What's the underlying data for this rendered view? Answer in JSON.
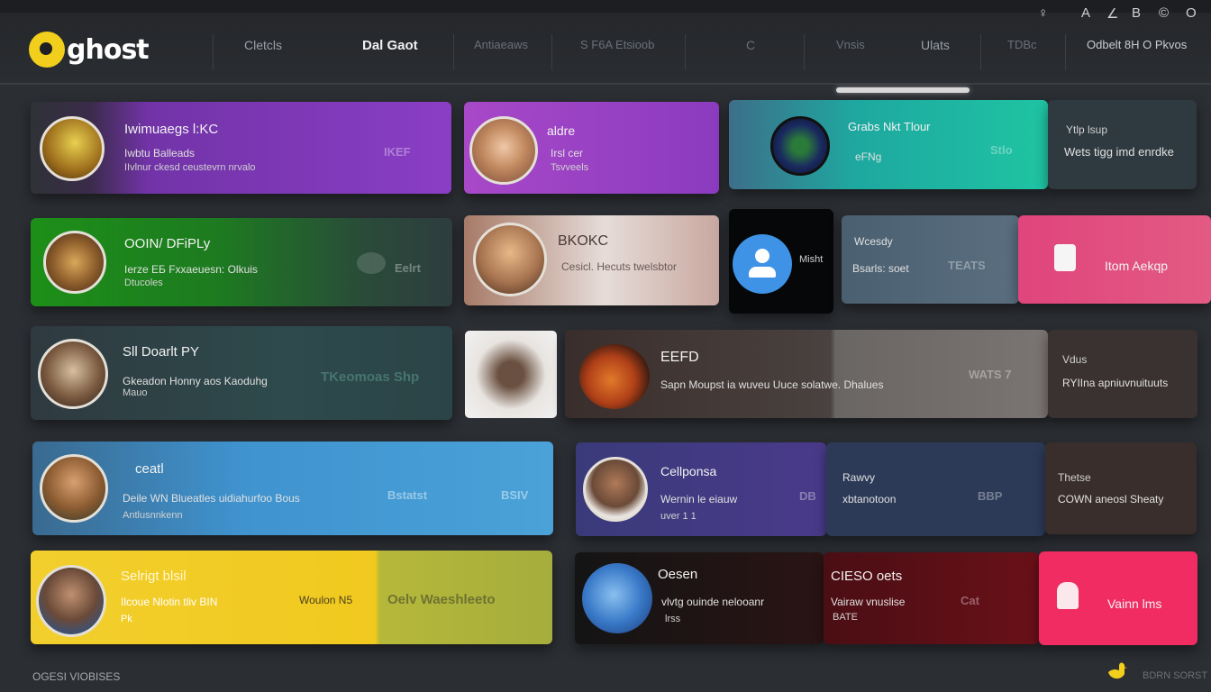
{
  "app": {
    "logo_text": "ghost"
  },
  "nav": [
    "Cletcls",
    "Dal Gaot",
    "Antiaeaws",
    "S F6A Etsioob",
    "C",
    "Vnsis",
    "Ulats",
    "TDBc",
    "Odbelt 8H O Pkvos"
  ],
  "tray_icons": [
    "user-icon",
    "bell-icon",
    "note-icon",
    "calendar-icon",
    "settings-icon",
    "circle-icon"
  ],
  "tray_glyphs": [
    "♀",
    "A",
    "∠",
    "B",
    "©",
    "O"
  ],
  "row1": {
    "c1": {
      "name": "Iwimuaegs l:KC",
      "line1": "Iwbtu Balleads",
      "line2": "IIvlnur ckesd ceustevrn nrvalo",
      "tag": "IKEF"
    },
    "c2": {
      "name": "aldre",
      "line1": "Irsl cer",
      "line2": "Tsvveels"
    },
    "c3": {
      "name": "Grabs Nkt Tlour",
      "line1": "eFNg",
      "tag": "Stlo"
    },
    "c4": {
      "line1": "Ytlp lsup",
      "line2": "Wets tigg imd enrdke"
    }
  },
  "row2": {
    "c1": {
      "name": "OOIN/ DFiPLy",
      "line1": "Ierze ЕБ Fxxaeuesn: Olkuis",
      "line2": "Dtucoles",
      "tag": "Eelrt"
    },
    "c2": {
      "name": "BKOKC",
      "line1": "Cesicl. Hecuts twelsbtor"
    },
    "c3": {
      "label": "Misht"
    },
    "c4": {
      "name": "Wcesdy",
      "line1": "Bsarls: soet",
      "tag": "TEATS"
    },
    "c5": {
      "label": "Itom Aekqp"
    }
  },
  "row3": {
    "c1": {
      "name": "Sll Doarlt PY",
      "line1": "Gkeadon Honny aos Kaoduhg",
      "line2": "Mauo",
      "tag": "TKeomoas Shp"
    },
    "c3": {
      "name": "EEFD",
      "line1": "Sapn Moupst ia wuveu Uuce solatwe. Dhalues",
      "tag": "WATS 7"
    },
    "c4": {
      "name": "Vdus",
      "line1": "RYIIna apniuvnuituuts"
    }
  },
  "row4": {
    "c1": {
      "name": "ceatl",
      "line1": "Deile WN Blueatles uidiahurfoo Bous",
      "line2": "Antlusnnkenn",
      "tag1": "Bstatst",
      "tag2": "BSIV"
    },
    "c2": {
      "name": "Cellponsa",
      "line1": "Wernin le eiauw",
      "line2": "uver 1 1",
      "tag": "DB"
    },
    "c3": {
      "name": "Rawvy",
      "line1": "xbtanotoon",
      "tag": "BBP"
    },
    "c4": {
      "name": "Thetse",
      "line1": "COWN aneosl Sheaty"
    }
  },
  "row5": {
    "c1": {
      "name": "Selrigt blsil",
      "line1": "Ilcoue Nlotin tliv BIN",
      "line2": "Pk",
      "tag1": "Woulon N5",
      "tag2": "Oelv Waeshleeto"
    },
    "c2": {
      "name": "Oesen",
      "line1": "vlvtg ouinde nelooanr",
      "line2": "lrss"
    },
    "c3": {
      "name": "CIESO oets",
      "line1": "Vairaw vnuslise",
      "line2": "BATE",
      "tag": "Cat"
    },
    "c4": {
      "label": "Vainn lms"
    }
  },
  "footer": {
    "left": "OGESI VIOBISES",
    "right": "BDRN SORST"
  },
  "colors": {
    "bg": "#2b2e33",
    "purple": "#8a3ec5",
    "teal": "#1fc4a3",
    "green": "#1d8f18",
    "pink": "#e0457c",
    "blue": "#3f93cf",
    "yellow": "#f2cf2d",
    "red": "#f02c62"
  }
}
